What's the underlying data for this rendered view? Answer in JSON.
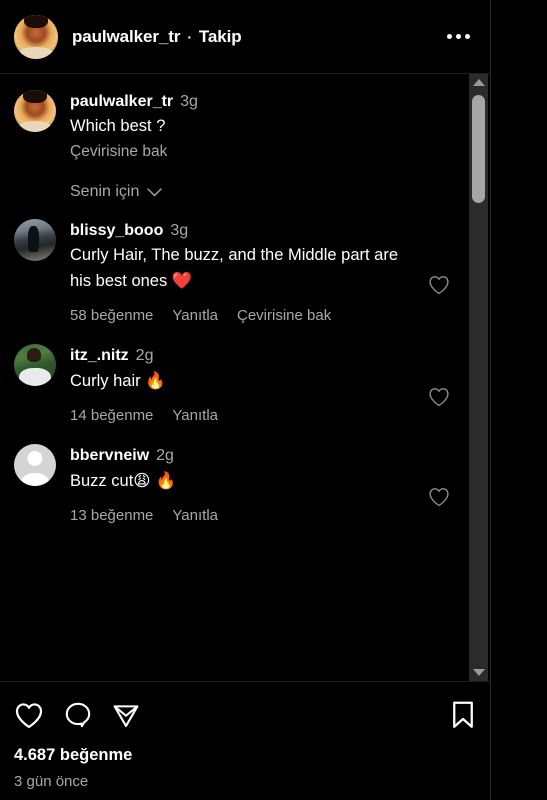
{
  "header": {
    "username": "paulwalker_tr",
    "separator": "·",
    "follow_label": "Takip",
    "more_icon": "ellipsis-icon"
  },
  "caption": {
    "username": "paulwalker_tr",
    "time": "3g",
    "text": "Which best ?",
    "translate_label": "Çevirisine bak"
  },
  "filter": {
    "label": "Senin için",
    "icon": "chevron-down-icon"
  },
  "comments": [
    {
      "username": "blissy_booo",
      "time": "3g",
      "text": "Curly Hair, The buzz, and the Middle part are his best ones ",
      "emoji": "❤️",
      "likes": "58 beğenme",
      "reply": "Yanıtla",
      "translate": "Çevirisine bak",
      "avatar": "av-dark-photo",
      "like_icon": "heart-outline-icon"
    },
    {
      "username": "itz_.nitz",
      "time": "2g",
      "text": "Curly hair ",
      "emoji": "🔥",
      "likes": "14 beğenme",
      "reply": "Yanıtla",
      "translate": "",
      "avatar": "av-green-photo",
      "like_icon": "heart-outline-icon"
    },
    {
      "username": "bbervneiw",
      "time": "2g",
      "text": "Buzz cut",
      "emoji": "😩 🔥",
      "likes": "13 beğenme",
      "reply": "Yanıtla",
      "translate": "",
      "avatar": "av-default",
      "like_icon": "heart-outline-icon"
    }
  ],
  "actions": {
    "like_icon": "heart-outline-icon",
    "comment_icon": "comment-bubble-icon",
    "share_icon": "share-paper-plane-icon",
    "save_icon": "bookmark-outline-icon",
    "likes_count": "4.687 beğenme",
    "time_ago": "3 gün önce"
  },
  "scrollbar": {
    "up_icon": "scroll-up-arrow-icon",
    "down_icon": "scroll-down-arrow-icon"
  },
  "colors": {
    "background": "#000000",
    "text_primary": "#ffffff",
    "text_secondary": "#a8a8a8",
    "divider": "#1e1e1e",
    "scroll_track": "#2b2b2b",
    "scroll_thumb": "#a6a6a6"
  }
}
